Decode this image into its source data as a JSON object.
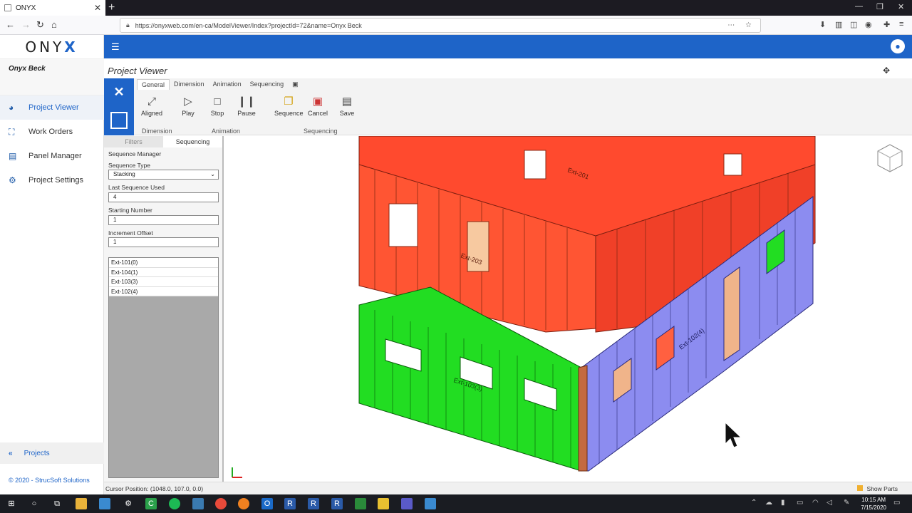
{
  "browser": {
    "tab_title": "ONYX",
    "url": "https://onyxweb.com/en-ca/ModelViewer/Index?projectId=72&name=Onyx Beck"
  },
  "sidebar": {
    "logo_left": "ONY",
    "logo_x": "X",
    "user": "Onyx Beck",
    "items": [
      {
        "label": "Project Viewer",
        "icon": "palette-icon"
      },
      {
        "label": "Work Orders",
        "icon": "work-orders-icon"
      },
      {
        "label": "Panel Manager",
        "icon": "document-icon"
      },
      {
        "label": "Project Settings",
        "icon": "gear-icon"
      }
    ],
    "projects_label": "Projects",
    "copyright": "© 2020 - StrucSoft Solutions"
  },
  "header": {
    "page_title": "Project Viewer"
  },
  "ribbon": {
    "tabs": [
      "General",
      "Dimension",
      "Animation",
      "Sequencing"
    ],
    "buttons": {
      "aligned": "Aligned",
      "play": "Play",
      "stop": "Stop",
      "pause": "Pause",
      "sequence": "Sequence",
      "cancel": "Cancel",
      "save": "Save"
    },
    "groups": {
      "dimension": "Dimension",
      "animation": "Animation",
      "sequencing": "Sequencing"
    }
  },
  "panel": {
    "tabs": [
      "Filters",
      "Sequencing"
    ],
    "title": "Sequence Manager",
    "sequence_type_label": "Sequence Type",
    "sequence_type_value": "Stacking",
    "last_sequence_label": "Last Sequence Used",
    "last_sequence_value": "4",
    "starting_number_label": "Starting Number",
    "starting_number_value": "1",
    "increment_offset_label": "Increment Offset",
    "increment_offset_value": "1",
    "list": [
      "Ext-101(0)",
      "Ext-104(1)",
      "Ext-103(3)",
      "Ext-102(4)"
    ]
  },
  "model": {
    "labels": [
      "Ext-103(3)",
      "Ext-102(4)",
      "Ext-201",
      "Ext-203"
    ],
    "colors": {
      "upper": "#ff4a2e",
      "front": "#22dd22",
      "side": "#8c8cf0",
      "frame": "#c46a40"
    }
  },
  "status": {
    "cursor_position": "Cursor Position: (1048.0, 107.0, 0.0)",
    "show_parts": "Show Parts"
  },
  "taskbar": {
    "time": "10:15 AM",
    "date": "7/15/2020"
  }
}
